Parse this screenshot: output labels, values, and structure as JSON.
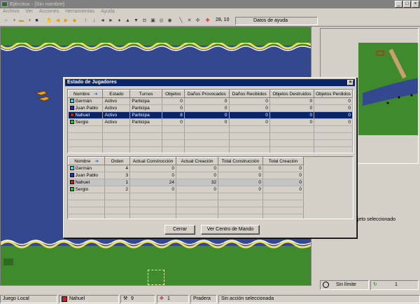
{
  "window": {
    "title": "Ejércitos - [Sin nombre]",
    "min": "_",
    "max": "□",
    "close": "×"
  },
  "menu": [
    "Archivo",
    "Ver",
    "Acciones",
    "Herramientas",
    "Ayuda"
  ],
  "toolbar": {
    "coords": "28, 10",
    "help_label": "Datos de ayuda"
  },
  "dialog": {
    "title": "Estado de Jugadores",
    "close": "×",
    "table1": {
      "headers": [
        "Nombre",
        "Estado",
        "Turnos",
        "Objetos",
        "Daños Provocados",
        "Daños Recibidos",
        "Objetos Destruidos",
        "Objetos Perdidos"
      ],
      "rows": [
        {
          "color": "#22e0e8",
          "name": "Germán",
          "estado": "Activo",
          "turnos": "Participa",
          "objetos": "0",
          "provocados": "0",
          "recibidos": "0",
          "destruidos": "0",
          "perdidos": "0"
        },
        {
          "color": "#1c2fd0",
          "name": "Juan Pablo",
          "estado": "Activo",
          "turnos": "Participa",
          "objetos": "0",
          "provocados": "0",
          "recibidos": "0",
          "destruidos": "0",
          "perdidos": "0"
        },
        {
          "color": "#c82020",
          "name": "Nahuel",
          "estado": "Activo",
          "turnos": "Participa",
          "objetos": "8",
          "provocados": "0",
          "recibidos": "0",
          "destruidos": "0",
          "perdidos": "0"
        },
        {
          "color": "#20c020",
          "name": "Sergio",
          "estado": "Activo",
          "turnos": "Participa",
          "objetos": "0",
          "provocados": "0",
          "recibidos": "0",
          "destruidos": "0",
          "perdidos": "0"
        }
      ]
    },
    "table2": {
      "headers": [
        "Nombre",
        "Orden",
        "Actual Construcción",
        "Actual Creación",
        "Total Construcción",
        "Total Creación"
      ],
      "rows": [
        {
          "color": "#22e0e8",
          "name": "Germán",
          "orden": "4",
          "ac": "0",
          "acr": "0",
          "tc": "0",
          "tcr": "0"
        },
        {
          "color": "#1c2fd0",
          "name": "Juan Pablo",
          "orden": "3",
          "ac": "0",
          "acr": "0",
          "tc": "0",
          "tcr": "0"
        },
        {
          "color": "#c82020",
          "name": "Nahuel",
          "orden": "1",
          "ac": "24",
          "acr": "32",
          "tc": "0",
          "tcr": "0"
        },
        {
          "color": "#20c020",
          "name": "Sergio",
          "orden": "2",
          "ac": "0",
          "acr": "0",
          "tc": "0",
          "tcr": "0"
        }
      ]
    },
    "close_button": "Cerrar",
    "command_button": "Ver Centro de Mando"
  },
  "side": {
    "object_text": "bjeto seleccionado",
    "limit": "Sin límite",
    "count": "1"
  },
  "status": {
    "mode": "Juego Local",
    "player": "Nahuel",
    "player_color": "#c82020",
    "tools": "9",
    "units": "1",
    "terrain": "Pradera",
    "action": "Sin acción seleccionada"
  },
  "colors": {
    "water": "#34488f",
    "grass": "#3f8a2c",
    "sand": "#f0e060",
    "selection": "#0a246a"
  }
}
